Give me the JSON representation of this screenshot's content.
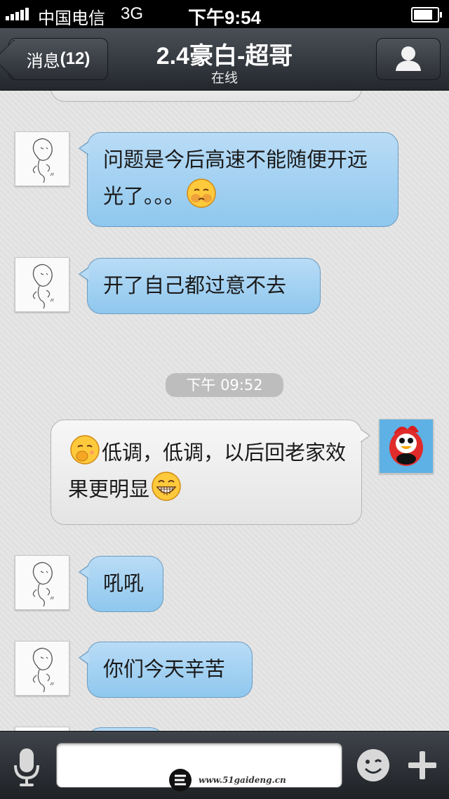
{
  "status_bar": {
    "carrier": "中国电信",
    "network": "3G",
    "time": "下午9:54",
    "battery_level": 0.85
  },
  "nav": {
    "back_label": "消息",
    "back_count": "(12)",
    "title": "2.4豪白-超哥",
    "subtitle": "在线",
    "profile_icon": "person-icon"
  },
  "messages": [
    {
      "side": "left",
      "text": "问题是今后高速不能随便开远光了。。。",
      "emoji": "sick-face"
    },
    {
      "side": "left",
      "text": "开了自己都过意不去"
    },
    {
      "timestamp": "下午 09:52"
    },
    {
      "side": "right",
      "lead_emoji": "shy-face",
      "text": "低调，低调，以后回老家效果更明显",
      "emoji": "grin-face"
    },
    {
      "side": "left",
      "text": "吼吼"
    },
    {
      "side": "left",
      "text": "你们今天辛苦"
    }
  ],
  "input_bar": {
    "placeholder": "",
    "mic_icon": "microphone-icon",
    "emoji_icon": "smiley-icon",
    "plus_icon": "plus-icon"
  },
  "watermark": {
    "text": "www.51gaideng.cn"
  },
  "colors": {
    "incoming_bubble": "#a9d4f3",
    "outgoing_bubble": "#efefef",
    "nav_bg": "#2e3237"
  }
}
